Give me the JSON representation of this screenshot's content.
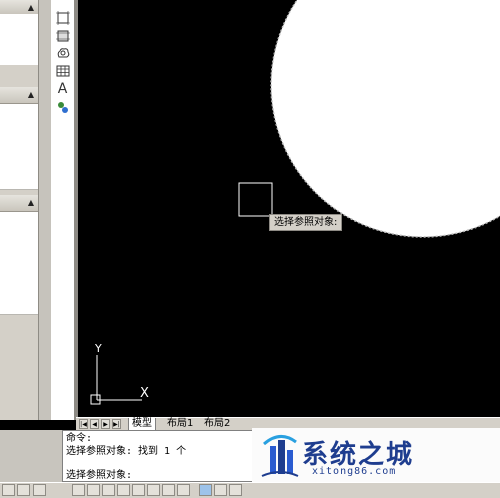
{
  "canvas": {
    "background": "#000000",
    "tooltip_text": "选择参照对象:"
  },
  "ucs": {
    "y_label": "Y",
    "x_label": "X"
  },
  "tabs": {
    "nav_first": "|◀",
    "nav_prev": "◀",
    "nav_next": "▶",
    "nav_last": "▶|",
    "items": [
      {
        "label": "模型",
        "active": true
      },
      {
        "label": "布局1",
        "active": false
      },
      {
        "label": "布局2",
        "active": false
      }
    ]
  },
  "command": {
    "lines": [
      "命令:",
      "选择参照对象: 找到 1 个",
      "",
      "选择参照对象:"
    ]
  },
  "palette": {
    "collapse_arrow": "▲"
  },
  "toolbar": {
    "tools": [
      {
        "icon": "region-icon"
      },
      {
        "icon": "wipeout-icon"
      },
      {
        "icon": "revision-cloud-icon"
      },
      {
        "icon": "table-icon"
      },
      {
        "icon": "multiline-text-icon",
        "glyph": "A"
      },
      {
        "icon": "add-selected-icon"
      }
    ]
  },
  "watermark": {
    "title": "系统之城",
    "subtitle": "xitong86.com",
    "color": "#1e3d8f"
  }
}
